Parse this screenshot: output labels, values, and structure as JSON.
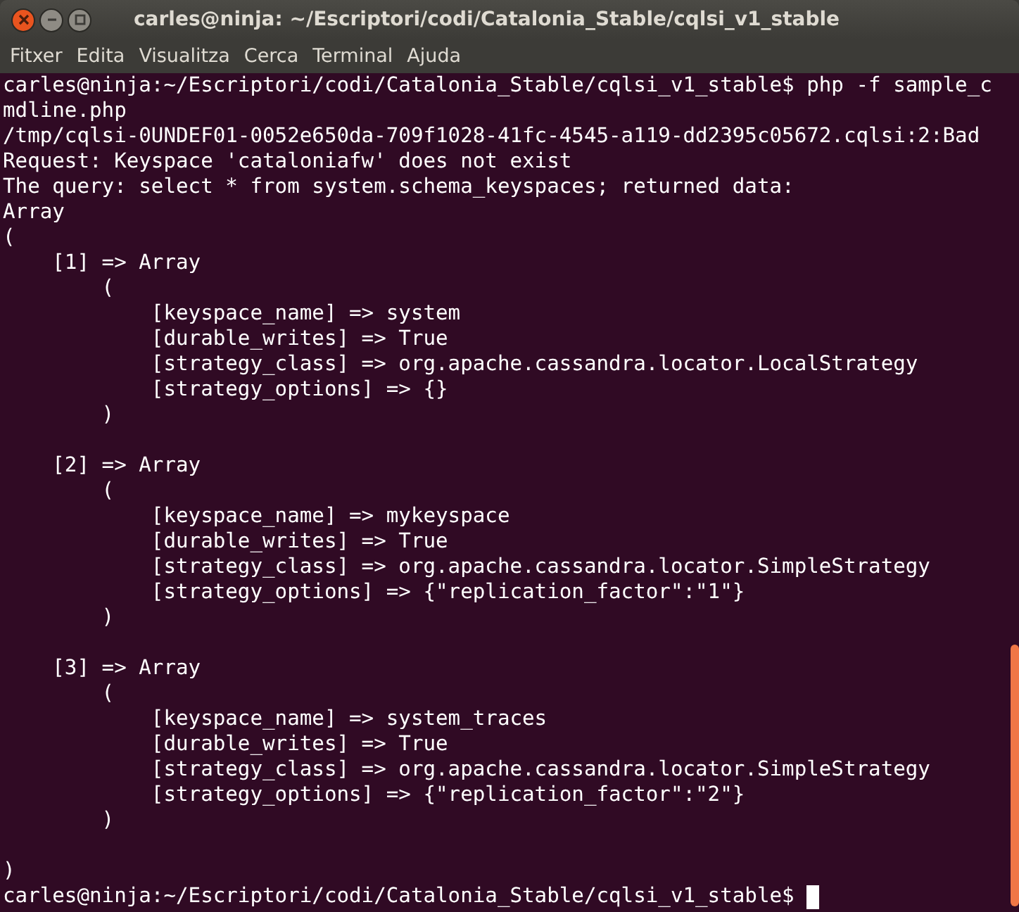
{
  "window": {
    "title": "carles@ninja: ~/Escriptori/codi/Catalonia_Stable/cqlsi_v1_stable"
  },
  "menu": [
    "Fitxer",
    "Edita",
    "Visualitza",
    "Cerca",
    "Terminal",
    "Ajuda"
  ],
  "terminal": {
    "lines": [
      {
        "kind": "text",
        "text": "carles@ninja:~/Escriptori/codi/Catalonia_Stable/cqlsi_v1_stable$ php -f sample_c"
      },
      {
        "kind": "text",
        "text": "mdline.php"
      },
      {
        "kind": "text",
        "text": "/tmp/cqlsi-0UNDEF01-0052e650da-709f1028-41fc-4545-a119-dd2395c05672.cqlsi:2:Bad"
      },
      {
        "kind": "text",
        "text": "Request: Keyspace 'cataloniafw' does not exist"
      },
      {
        "kind": "text",
        "text": "The query: select * from system.schema_keyspaces; returned data:"
      },
      {
        "kind": "text",
        "text": "Array"
      },
      {
        "kind": "text",
        "text": "("
      },
      {
        "kind": "text",
        "text": "    [1] => Array"
      },
      {
        "kind": "text",
        "text": "        ("
      },
      {
        "kind": "text",
        "text": "            [keyspace_name] => system"
      },
      {
        "kind": "text",
        "text": "            [durable_writes] => True"
      },
      {
        "kind": "text",
        "text": "            [strategy_class] => org.apache.cassandra.locator.LocalStrategy"
      },
      {
        "kind": "text",
        "text": "            [strategy_options] => {}"
      },
      {
        "kind": "text",
        "text": "        )"
      },
      {
        "kind": "blank"
      },
      {
        "kind": "text",
        "text": "    [2] => Array"
      },
      {
        "kind": "text",
        "text": "        ("
      },
      {
        "kind": "text",
        "text": "            [keyspace_name] => mykeyspace"
      },
      {
        "kind": "text",
        "text": "            [durable_writes] => True"
      },
      {
        "kind": "text",
        "text": "            [strategy_class] => org.apache.cassandra.locator.SimpleStrategy"
      },
      {
        "kind": "text",
        "text": "            [strategy_options] => {\"replication_factor\":\"1\"}"
      },
      {
        "kind": "text",
        "text": "        )"
      },
      {
        "kind": "blank"
      },
      {
        "kind": "text",
        "text": "    [3] => Array"
      },
      {
        "kind": "text",
        "text": "        ("
      },
      {
        "kind": "text",
        "text": "            [keyspace_name] => system_traces"
      },
      {
        "kind": "text",
        "text": "            [durable_writes] => True"
      },
      {
        "kind": "text",
        "text": "            [strategy_class] => org.apache.cassandra.locator.SimpleStrategy"
      },
      {
        "kind": "text",
        "text": "            [strategy_options] => {\"replication_factor\":\"2\"}"
      },
      {
        "kind": "text",
        "text": "        )"
      },
      {
        "kind": "blank"
      },
      {
        "kind": "text",
        "text": ")"
      },
      {
        "kind": "prompt",
        "text": "carles@ninja:~/Escriptori/codi/Catalonia_Stable/cqlsi_v1_stable$"
      }
    ]
  }
}
